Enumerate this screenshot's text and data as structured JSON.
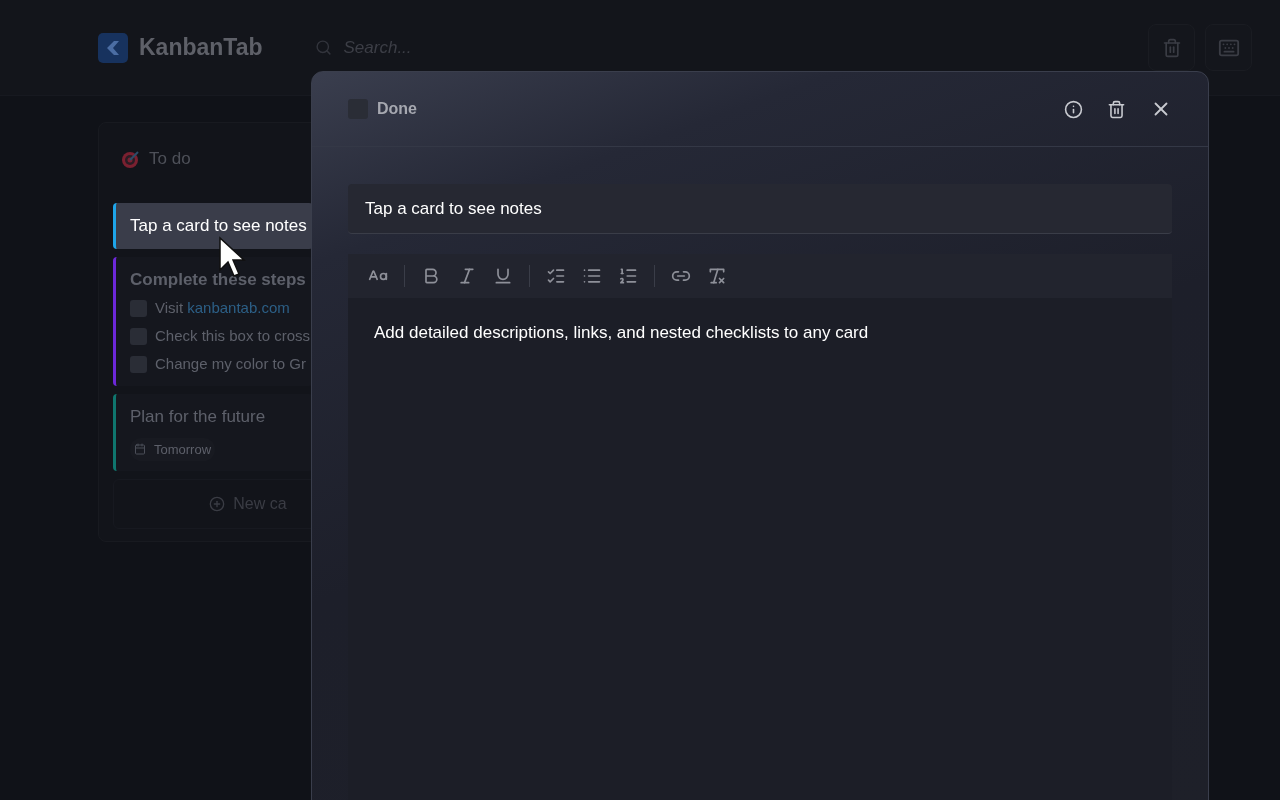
{
  "header": {
    "app_name": "KanbanTab",
    "search": {
      "placeholder": "Search..."
    }
  },
  "column": {
    "title": "To do",
    "cards": [
      {
        "kind": "text",
        "title": "Tap a card to see notes",
        "color": "#1ea5e9",
        "selected": true
      },
      {
        "kind": "checklist",
        "title": "Complete these steps",
        "color": "#6d28d9",
        "selected": false,
        "items": [
          {
            "text": "Visit ",
            "link": "kanbantab.com",
            "checked": false
          },
          {
            "text": "Check this box to cross",
            "checked": false
          },
          {
            "text": "Change my color to Gr",
            "checked": false
          }
        ]
      },
      {
        "kind": "dated",
        "title": "Plan for the future",
        "color": "#0f766e",
        "selected": false,
        "date": "Tomorrow"
      }
    ],
    "new_card": "New ca"
  },
  "modal": {
    "done": {
      "label": "Done",
      "checked": false
    },
    "title_value": "Tap a card to see notes",
    "body": "Add detailed descriptions, links, and nested checklists to any card"
  }
}
